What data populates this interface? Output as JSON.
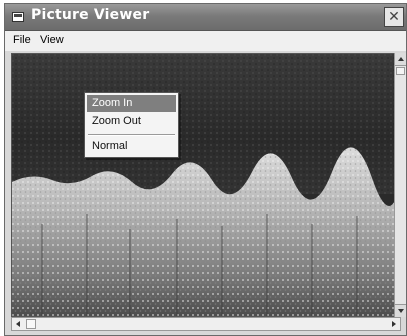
{
  "window": {
    "title": "Picture Viewer",
    "close_symbol": "✕"
  },
  "menubar": {
    "items": [
      {
        "label": "File"
      },
      {
        "label": "View"
      }
    ]
  },
  "context_menu": {
    "items": [
      {
        "label": "Zoom In",
        "highlighted": true
      },
      {
        "label": "Zoom Out",
        "highlighted": false
      },
      {
        "label": "Normal",
        "highlighted": false
      }
    ]
  },
  "icons": {
    "app": "picture-icon",
    "close": "close-icon"
  }
}
